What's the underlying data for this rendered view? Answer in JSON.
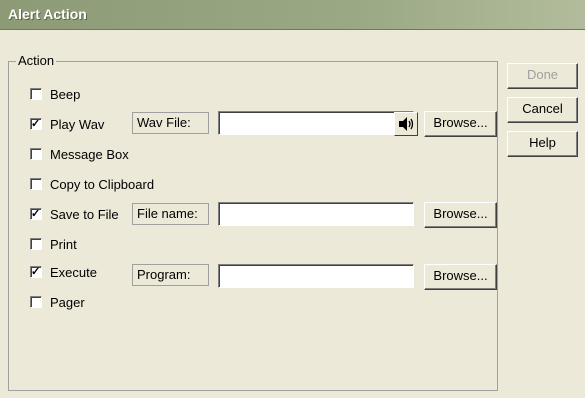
{
  "window": {
    "title": "Alert Action"
  },
  "group": {
    "label": "Action"
  },
  "actions": [
    {
      "label": "Beep",
      "checked": false
    },
    {
      "label": "Play Wav",
      "checked": true
    },
    {
      "label": "Message Box",
      "checked": false
    },
    {
      "label": "Copy to Clipboard",
      "checked": false
    },
    {
      "label": "Save to File",
      "checked": true
    },
    {
      "label": "Print",
      "checked": false
    },
    {
      "label": "Execute",
      "checked": true
    },
    {
      "label": "Pager",
      "checked": false
    }
  ],
  "fields": {
    "wav": {
      "label": "Wav File:",
      "value": ""
    },
    "file": {
      "label": "File name:",
      "value": ""
    },
    "program": {
      "label": "Program:",
      "value": ""
    }
  },
  "buttons": {
    "browse": "Browse...",
    "done": "Done",
    "cancel": "Cancel",
    "help": "Help"
  },
  "icons": {
    "speaker": "speaker-icon"
  }
}
